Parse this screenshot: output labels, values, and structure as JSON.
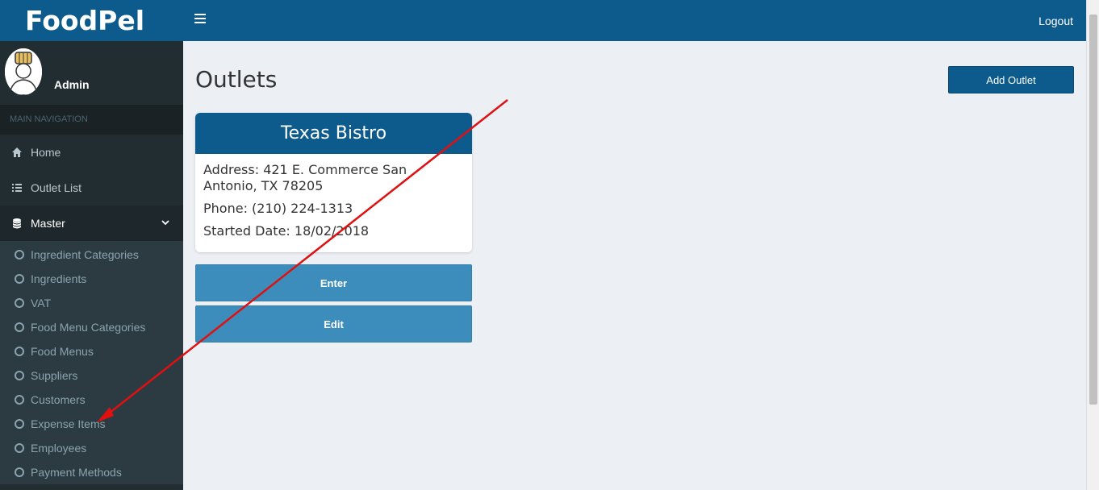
{
  "app": {
    "brand": "FoodPel",
    "logout_label": "Logout"
  },
  "user": {
    "name": "Admin"
  },
  "sidebar": {
    "header": "MAIN NAVIGATION",
    "items": [
      {
        "label": "Home",
        "icon": "home-icon"
      },
      {
        "label": "Outlet List",
        "icon": "list-icon"
      },
      {
        "label": "Master",
        "icon": "database-icon",
        "expanded": true
      }
    ],
    "submenu": [
      "Ingredient Categories",
      "Ingredients",
      "VAT",
      "Food Menu Categories",
      "Food Menus",
      "Suppliers",
      "Customers",
      "Expense Items",
      "Employees",
      "Payment Methods"
    ]
  },
  "main": {
    "title": "Outlets",
    "add_button": "Add Outlet",
    "outlet": {
      "name": "Texas Bistro",
      "address": "Address: 421 E. Commerce San Antonio, TX 78205",
      "phone": "Phone: (210) 224-1313",
      "started": "Started Date: 18/02/2018"
    },
    "enter_button": "Enter",
    "edit_button": "Edit"
  },
  "colors": {
    "primary": "#0d5b8c",
    "sidebar": "#222d32",
    "button": "#3c8dbc",
    "annotation_arrow": "#e01010"
  }
}
